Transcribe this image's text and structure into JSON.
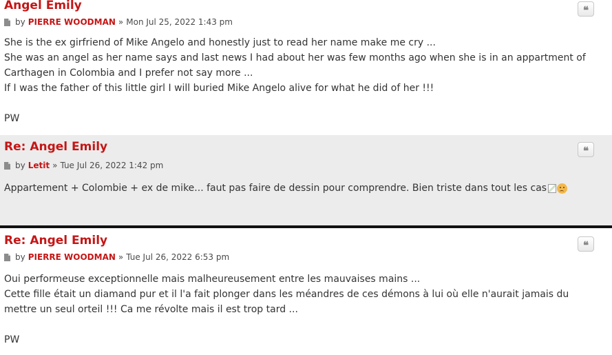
{
  "posts": [
    {
      "title": "Angel Emily",
      "by": "by",
      "author": "PIERRE WOODMAN",
      "sep": "»",
      "date": "Mon Jul 25, 2022 1:43 pm",
      "quote_icon": "quote-icon",
      "lines": [
        "She is the ex girfriend of Mike Angelo and honestly just to read her name make me cry ...",
        "She was an angel as her name says and last news I had about her was few months ago when she is in an appartment of",
        "Carthagen in Colombia and I prefer not say more ...",
        "If I was the father of this little girl I will buried Mike Angelo alive for what he did of her !!!",
        "",
        "PW"
      ]
    },
    {
      "title": "Re: Angel Emily",
      "by": "by",
      "author": "Letit",
      "sep": "»",
      "date": "Tue Jul 26, 2022 1:42 pm",
      "quote_icon": "quote-icon",
      "lines": [
        "Appartement + Colombie + ex de mike... faut pas faire de dessin pour comprendre. Bien triste dans tout les cas"
      ],
      "emoji": "sad-face-icon"
    },
    {
      "title": "Re: Angel Emily",
      "by": "by",
      "author": "PIERRE WOODMAN",
      "sep": "»",
      "date": "Tue Jul 26, 2022 6:53 pm",
      "quote_icon": "quote-icon",
      "lines": [
        "Oui performeuse exceptionnelle mais malheureusement entre les mauvaises mains ...",
        "Cette fille était un diamand pur et il l'a fait plonger dans les méandres de ces démons à lui où elle n'aurait jamais du",
        "mettre un seul orteil !!! Ca me révolte mais il est trop tard ...",
        "",
        "PW"
      ]
    }
  ],
  "colors": {
    "title": "#c51616",
    "author": "#c51616",
    "alt_row_bg": "#ececec",
    "text": "#333333"
  },
  "quote_glyph": "❝"
}
